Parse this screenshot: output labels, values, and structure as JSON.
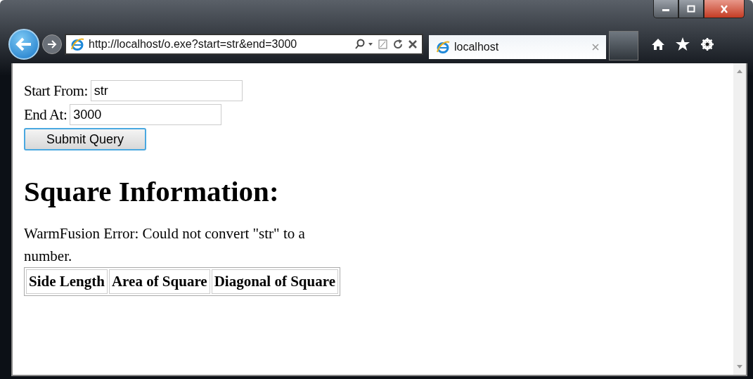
{
  "address_bar": {
    "url": "http://localhost/o.exe?start=str&end=3000"
  },
  "tabs": [
    {
      "label": "localhost",
      "selected": true
    }
  ],
  "form": {
    "fields": [
      {
        "label": "Start From:",
        "value": "str"
      },
      {
        "label": "End At:",
        "value": "3000"
      }
    ],
    "submit": "Submit Query"
  },
  "heading": "Square Information:",
  "error": "WarmFusion Error: Could not convert \"str\" to a number.",
  "table": {
    "columns": [
      "Side Length",
      "Area of Square",
      "Diagonal of Square"
    ]
  }
}
